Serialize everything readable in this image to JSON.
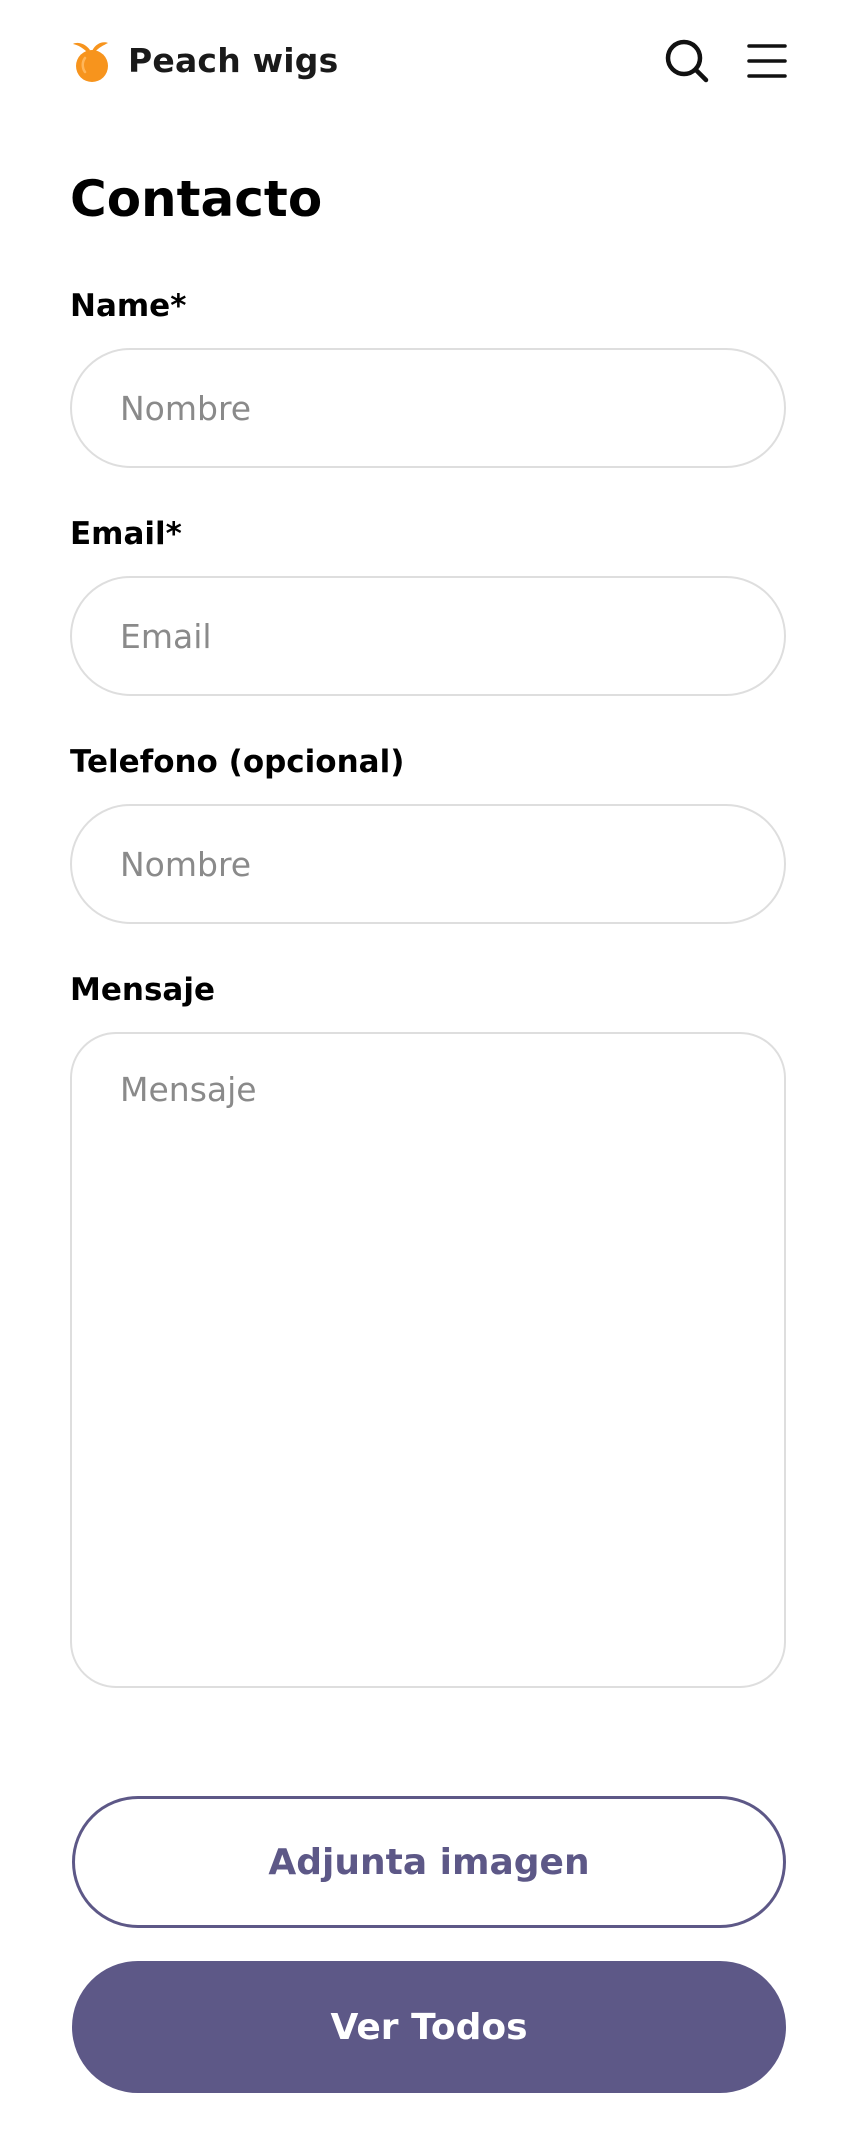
{
  "header": {
    "brand": "Peach wigs",
    "logo_icon": "peach-icon",
    "search_icon": "search-icon",
    "menu_icon": "hamburger-menu-icon"
  },
  "page": {
    "title": "Contacto"
  },
  "form": {
    "name_label": "Name*",
    "name_placeholder": "Nombre",
    "email_label": "Email*",
    "email_placeholder": "Email",
    "phone_label": "Telefono (opcional)",
    "phone_placeholder": "Nombre",
    "message_label": "Mensaje",
    "message_placeholder": "Mensaje"
  },
  "actions": {
    "attach_label": "Adjunta imagen",
    "submit_label": "Ver Todos"
  },
  "colors": {
    "accent": "#5d5887",
    "logo": "#f7941d",
    "input_border": "#dedede"
  }
}
